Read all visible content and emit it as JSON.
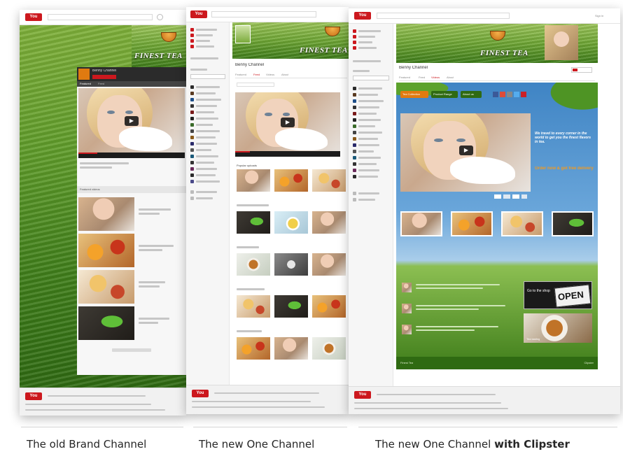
{
  "captions": {
    "old": "The old Brand Channel",
    "new": "The new One Channel",
    "clipster_prefix": "The new One Channel ",
    "clipster_bold": "with Clipster"
  },
  "panels": {
    "logo_text": "You",
    "brand_logo": "FINEST TEA",
    "play_icon": "▶",
    "mockup_text": {
      "channel_name": "Benny Channel",
      "sign_in": "Sign in",
      "tab_featured": "Featured",
      "tab_feed": "Feed",
      "tab_videos": "Videos",
      "tab_about": "About",
      "section_featured": "Featured videos",
      "section_popular": "Popular uploads",
      "button_collection": "Tea Collection",
      "button_shop": "Product Range",
      "button_about": "About us",
      "promo_text": "We travel to every corner in the world to get you the finest flavors in tea.",
      "promo_cta": "Order now & get free delivery",
      "open_sign": "OPEN",
      "shop_label": "Go to the shop",
      "tea_tag": "Tea tasting",
      "footer_tagline": "Finest Tea",
      "powered": "Clipster"
    }
  },
  "colors": {
    "youtube_red": "#cc181e",
    "tea_green": "#3c7a1e",
    "sky_blue": "#4a88c8",
    "orange_button": "#e07a10"
  }
}
